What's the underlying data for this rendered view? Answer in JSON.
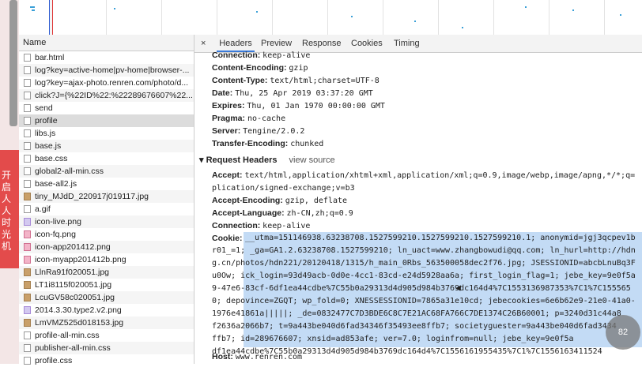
{
  "left_strip_text": "开启人人时光机",
  "name_header": "Name",
  "files": [
    {
      "name": "bar.html",
      "icon": "document-icon"
    },
    {
      "name": "log?key=active-home|pv-home|browser-...",
      "icon": "document-icon"
    },
    {
      "name": "log?key=ajax-photo.renren.com/photo/d...",
      "icon": "document-icon"
    },
    {
      "name": "click?J={%22ID%22:%22289676607%22...",
      "icon": "document-icon"
    },
    {
      "name": "send",
      "icon": "document-icon"
    },
    {
      "name": "profile",
      "icon": "document-icon"
    },
    {
      "name": "libs.js",
      "icon": "document-icon"
    },
    {
      "name": "base.js",
      "icon": "document-icon"
    },
    {
      "name": "base.css",
      "icon": "document-icon"
    },
    {
      "name": "global2-all-min.css",
      "icon": "document-icon"
    },
    {
      "name": "base-all2.js",
      "icon": "document-icon"
    },
    {
      "name": "tiny_MJdD_220917j019117.jpg",
      "icon": "image-icon"
    },
    {
      "name": "a.gif",
      "icon": "document-icon"
    },
    {
      "name": "icon-live.png",
      "icon": "image-icon"
    },
    {
      "name": "icon-fq.png",
      "icon": "image-icon"
    },
    {
      "name": "icon-app201412.png",
      "icon": "image-icon"
    },
    {
      "name": "icon-myapp201412b.png",
      "icon": "image-icon"
    },
    {
      "name": "LlnRa91f020051.jpg",
      "icon": "image-icon"
    },
    {
      "name": "LT1i8115f020051.jpg",
      "icon": "image-icon"
    },
    {
      "name": "LcuGV58c020051.jpg",
      "icon": "image-icon"
    },
    {
      "name": "2014.3.30.type2.v2.png",
      "icon": "image-icon"
    },
    {
      "name": "LmVMZ525d018153.jpg",
      "icon": "image-icon"
    },
    {
      "name": "profile-all-min.css",
      "icon": "document-icon"
    },
    {
      "name": "publisher-all-min.css",
      "icon": "document-icon"
    },
    {
      "name": "profile.css",
      "icon": "document-icon"
    }
  ],
  "selected_file": "profile",
  "tabs": {
    "close": "×",
    "headers": "Headers",
    "preview": "Preview",
    "response": "Response",
    "cookies": "Cookies",
    "timing": "Timing"
  },
  "response_headers": [
    {
      "key": "Connection:",
      "value": "keep-alive"
    },
    {
      "key": "Content-Encoding:",
      "value": "gzip"
    },
    {
      "key": "Content-Type:",
      "value": "text/html;charset=UTF-8"
    },
    {
      "key": "Date:",
      "value": "Thu, 25 Apr 2019 03:37:20 GMT"
    },
    {
      "key": "Expires:",
      "value": "Thu, 01 Jan 1970 00:00:00 GMT"
    },
    {
      "key": "Pragma:",
      "value": "no-cache"
    },
    {
      "key": "Server:",
      "value": "Tengine/2.0.2"
    },
    {
      "key": "Transfer-Encoding:",
      "value": "chunked"
    }
  ],
  "request_section": {
    "title": "Request Headers",
    "view_source": "view source"
  },
  "accept": {
    "key": "Accept:",
    "line1": "text/html,application/xhtml+xml,application/xml;q=0.9,image/webp,image/apng,*/*;q=",
    "line2": "plication/signed-exchange;v=b3"
  },
  "request_headers": [
    {
      "key": "Accept-Encoding:",
      "value": "gzip, deflate"
    },
    {
      "key": "Accept-Language:",
      "value": "zh-CN,zh;q=0.9"
    },
    {
      "key": "Connection:",
      "value": "keep-alive"
    }
  ],
  "cookie": {
    "key": "Cookie:",
    "lines": [
      "__utma=151146938.63238708.1527599210.1527599210.1527599210.1; anonymid=jgj3qcpev1b",
      "r01_=1; _ga=GA1.2.63238708.1527599210; ln_uact=www.zhangbowudi@qq.com; ln_hurl=http://hdn",
      "g.cn/photos/hdn221/20120418/1315/h_main_0Rbs_563500058dec2f76.jpg; JSESSIONID=abcbLnuBq3F",
      "u0Ow; ick_login=93d49acb-0d0e-4cc1-83cd-e24d5928aa6a; first_login_flag=1; jebe_key=9e0f5a",
      "9-47e6-83cf-6df1ea44cdbe%7C55b0a29313d4d905d984b3769dc164d4%7C1553136987353%7C1%7C155565",
      "0; depovince=ZGQT; wp_fold=0; XNESSESSIONID=7865a31e10cd; jebecookies=6e6b62e9-21e0-41a0-",
      "1976e41861a|||||; _de=0832477C7D3BDE6C8C7E21AC68FA766C7DE1374C26B60001; p=3240d31c44a8",
      "f2636a2066b7; t=9a443be040d6fad34346f35493ee8ffb7; societyguester=9a443be040d6fad3434",
      "ffb7; id=289676607; xnsid=ad853afe; ver=7.0; loginfrom=null; jebe_key=9e0f5a",
      "df1ea44cdbe%7C55b0a29313d4d905d984b3769dc164d4%7C1556161955435%7C1%7C1556163411524"
    ]
  },
  "host": {
    "key": "Host:",
    "value": "www.renren.com"
  },
  "badge_text": "82"
}
